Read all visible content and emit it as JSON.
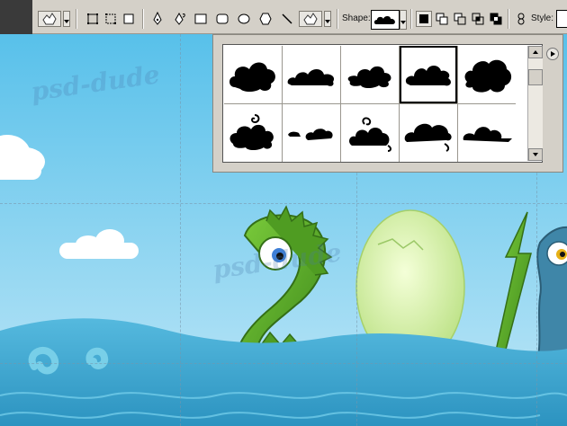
{
  "toolbar": {
    "shape_label": "Shape:",
    "style_label": "Style:",
    "tools": [
      "custom-shape-preset",
      "shape-layers-mode",
      "paths-mode",
      "fill-pixels-mode",
      "pen-tool",
      "freeform-pen-tool",
      "rectangle-tool",
      "rounded-rectangle-tool",
      "ellipse-tool",
      "polygon-tool",
      "line-tool",
      "custom-shape-tool"
    ],
    "selected_shape": "cloud-3",
    "combine_modes": [
      "new-layer",
      "add",
      "subtract",
      "intersect",
      "exclude"
    ]
  },
  "shape_picker": {
    "shapes": [
      "cloud-1",
      "cloud-2",
      "cloud-3",
      "cloud-4",
      "cloud-5",
      "cloud-6",
      "cloud-7",
      "cloud-8",
      "cloud-9",
      "cloud-10"
    ],
    "selected_index": 3
  },
  "canvas": {
    "watermark_1": "psd-dude",
    "watermark_2": "psd-dude",
    "sky_color": "#5cc4ec",
    "sea_color": "#40a9d1",
    "dragon_green": "#5daa2a",
    "egg_color": "#d8f0a8"
  }
}
